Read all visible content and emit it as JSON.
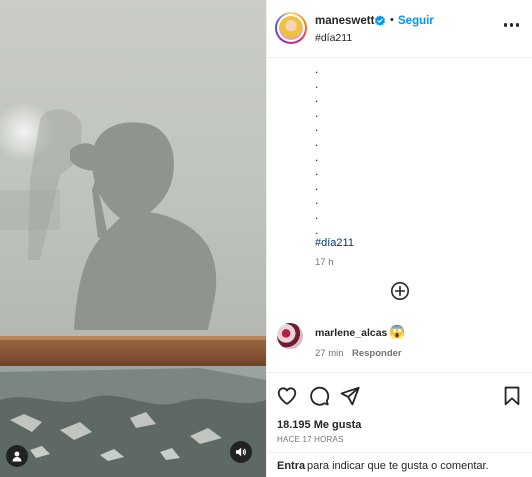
{
  "header": {
    "username": "maneswett",
    "separator": "•",
    "follow_label": "Seguir",
    "caption_tag": "#día211"
  },
  "caption": {
    "dots": [
      ".",
      ".",
      ".",
      ".",
      ".",
      ".",
      ".",
      ".",
      ".",
      ".",
      ".",
      "."
    ],
    "hashtag": "#día211",
    "age": "17 h"
  },
  "comment": {
    "username": "marlene_alcas",
    "emoji": "😱",
    "time": "27 min",
    "reply_label": "Responder"
  },
  "engagement": {
    "likes": "18.195 Me gusta",
    "posted_ago": "HACE 17 HORAS"
  },
  "login_prompt": {
    "link": "Entra",
    "text": "para indicar que te gusta o comentar."
  },
  "icons": {
    "like": "heart-icon",
    "comment": "comment-icon",
    "share": "send-icon",
    "save": "bookmark-icon",
    "more": "more-options-icon",
    "verified": "verified-badge-icon",
    "load_more": "plus-circle-icon",
    "user_tag": "user-tag-icon",
    "audio": "speaker-icon"
  },
  "colors": {
    "follow": "#0095f6",
    "verified": "#0095f6",
    "hashtag": "#00376b",
    "muted": "#737373"
  }
}
